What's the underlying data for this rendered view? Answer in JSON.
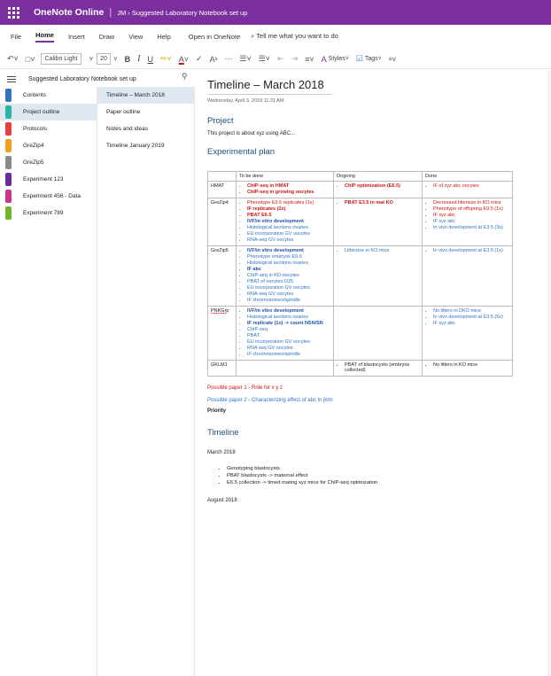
{
  "titlebar": {
    "app_name": "OneNote Online",
    "crumb": "JM › Suggested Laboratory Notebook set up",
    "color": "#7b2f9e"
  },
  "menu": {
    "items": [
      "File",
      "Home",
      "Insert",
      "Draw",
      "View",
      "Help",
      "Open in OneNote",
      "⌕ Tell me what you want to do"
    ]
  },
  "toolbar": {
    "font": "Calibri Light",
    "size": "20",
    "styles": "Styles",
    "tags": "Tags"
  },
  "notebook": {
    "name": "Suggested Laboratory Notebook set up"
  },
  "sections": [
    {
      "label": "Contents",
      "color": "#2e73c4"
    },
    {
      "label": "Project outline",
      "color": "#2ab3a5"
    },
    {
      "label": "Protocols",
      "color": "#e8413b"
    },
    {
      "label": "GreZip4",
      "color": "#f2a01b"
    },
    {
      "label": "GreZip5",
      "color": "#8a8a8a"
    },
    {
      "label": "Experiment 123",
      "color": "#6b2aa0"
    },
    {
      "label": "Experiment 456 - Data",
      "color": "#c8378c"
    },
    {
      "label": "Experiment 789",
      "color": "#72b52a"
    }
  ],
  "pages": [
    "Timeline – March 2018",
    "Paper outline",
    "Notes and ideas",
    "Timeline January 2019"
  ],
  "page": {
    "title": "Timeline – March 2018",
    "date": "Wednesday, April 3, 2019   11:31 AM",
    "h_project": "Project",
    "project_text": "This project is about xyz using ABC...",
    "h_plan": "Experimental plan",
    "table_headers": [
      "",
      "To be done",
      "Ongoing",
      "Done"
    ],
    "red_line": "Possible paper 1 - Role for x y z",
    "blue_line": "Possible paper 2 - Characterizing effect of abc in jklm",
    "priority": "Priority",
    "h_timeline": "Timeline",
    "month1": "March 2018",
    "bullets": [
      "Genotyping blastocysts",
      "PBAT blastocysts -> maternal effect",
      "E6.5 collection -> timed mating xyz mice for ChIP-seq optimization"
    ],
    "month2": "August 2018"
  },
  "rows": [
    {
      "name": "HMAT",
      "todo": [
        {
          "t": "ChIP-seq in HMAT",
          "c": "rb"
        },
        {
          "t": "ChIP-seq in growing oocytes",
          "c": "rb"
        }
      ],
      "ongoing": [
        {
          "t": "ChIP optimization (E6.5)",
          "c": "rb"
        }
      ],
      "done": [
        {
          "t": "IF of xyz abc oocytes",
          "c": "r"
        }
      ]
    },
    {
      "name": "GreZip4",
      "todo": [
        {
          "t": "Phenotype E9.5 replicates (1x)",
          "c": "r"
        },
        {
          "t": "IF replicates (2x)",
          "c": "rb"
        },
        {
          "t": "PBAT E6.5",
          "c": "rb"
        },
        {
          "t": "IVF/in vitro development",
          "c": "bb"
        },
        {
          "t": "Histological sections ovaries",
          "c": "b"
        },
        {
          "t": "EU incorporation GV oocytes",
          "c": "b"
        },
        {
          "t": "RNA-seq GV oocytes",
          "c": "b"
        }
      ],
      "ongoing": [
        {
          "t": "PBAT E3.5 in mat KO",
          "c": "rb"
        }
      ],
      "done": [
        {
          "t": "Decreased littersize in KO mice",
          "c": "r"
        },
        {
          "t": "Phenotype of offspring E9.5 (1x)",
          "c": "r"
        },
        {
          "t": "IF xyz abc",
          "c": "r"
        },
        {
          "t": "IF xyz abc",
          "c": "b"
        },
        {
          "t": "In vivo development at E3.5 (3x)",
          "c": "b"
        }
      ]
    },
    {
      "name": "GreZip5",
      "todo": [
        {
          "t": "IVF/in vitro development",
          "c": "bb"
        },
        {
          "t": "Phenotype embryos E9.5",
          "c": "b"
        },
        {
          "t": "Histological sections ovaries",
          "c": "b"
        },
        {
          "t": "IF abc",
          "c": "bb"
        },
        {
          "t": "ChIP-seq in KO oocytes",
          "c": "b"
        },
        {
          "t": "PBAT of oocytes D25",
          "c": "b"
        },
        {
          "t": "EU incorporation GV oocytes",
          "c": "b"
        },
        {
          "t": "RNA-seq GV oocytes",
          "c": "b"
        },
        {
          "t": "IF chromosomes/spindle",
          "c": "b"
        }
      ],
      "ongoing": [
        {
          "t": "Littersize in KO mice",
          "c": "b"
        }
      ],
      "done": [
        {
          "t": "In vivo development at E3.5 (1x)",
          "c": "b"
        }
      ]
    },
    {
      "name": "PNKGrp",
      "todo": [
        {
          "t": "IVF/in vitro development",
          "c": "bb"
        },
        {
          "t": "Histological sections ovaries",
          "c": "b"
        },
        {
          "t": "IF replicate (1x) -> count NSN/SN",
          "c": "bb"
        },
        {
          "t": "ChIP-seq",
          "c": "b"
        },
        {
          "t": "PBAT",
          "c": "b"
        },
        {
          "t": "EU incorporation GV oocytes",
          "c": "b"
        },
        {
          "t": "RNA seq GV oocytes",
          "c": "b"
        },
        {
          "t": "IF chromosomes/spindle",
          "c": "b"
        }
      ],
      "ongoing": [],
      "done": [
        {
          "t": "No litters in DKO mice",
          "c": "b"
        },
        {
          "t": "In vivo development at E3.5 (5x)",
          "c": "b"
        },
        {
          "t": "IF xyz abc",
          "c": "b"
        }
      ]
    },
    {
      "name": "GKLM1",
      "todo": [],
      "ongoing": [
        {
          "t": "PBAT of blastocysts (embryos collected)",
          "c": "k"
        }
      ],
      "done": [
        {
          "t": "No litters in KO mice",
          "c": "k"
        }
      ]
    }
  ]
}
